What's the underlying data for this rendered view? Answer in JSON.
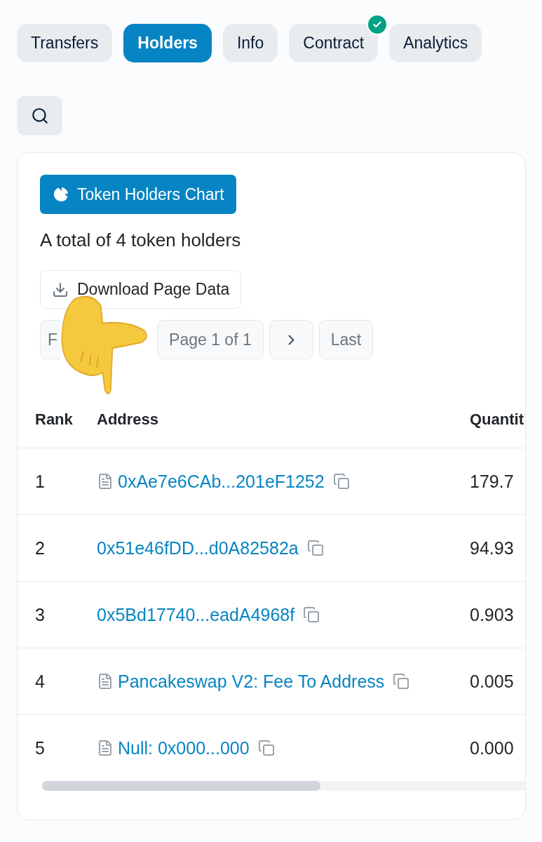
{
  "tabs": [
    {
      "label": "Transfers",
      "selected": false,
      "verified": false
    },
    {
      "label": "Holders",
      "selected": true,
      "verified": false
    },
    {
      "label": "Info",
      "selected": false,
      "verified": false
    },
    {
      "label": "Contract",
      "selected": false,
      "verified": true
    },
    {
      "label": "Analytics",
      "selected": false,
      "verified": false
    }
  ],
  "chart_button": "Token Holders Chart",
  "summary": "A total of 4 token holders",
  "download_button": "Download Page Data",
  "pagination": {
    "first": "F",
    "page": "Page 1 of 1",
    "last": "Last"
  },
  "table": {
    "columns": [
      "Rank",
      "Address",
      "Quantit"
    ],
    "rows": [
      {
        "rank": "1",
        "kind": "contract",
        "address": "0xAe7e6CAb...201eF1252",
        "quantity": "179.7"
      },
      {
        "rank": "2",
        "kind": "wallet",
        "address": "0x51e46fDD...d0A82582a",
        "quantity": "94.93"
      },
      {
        "rank": "3",
        "kind": "wallet",
        "address": "0x5Bd17740...eadA4968f",
        "quantity": "0.903"
      },
      {
        "rank": "4",
        "kind": "contract",
        "address": "Pancakeswap V2: Fee To Address",
        "quantity": "0.005"
      },
      {
        "rank": "5",
        "kind": "contract",
        "address": "Null: 0x000...000",
        "quantity": "0.000"
      }
    ]
  }
}
